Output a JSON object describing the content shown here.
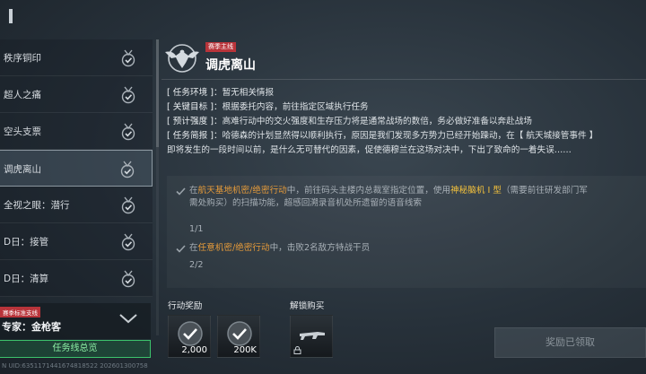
{
  "quest_list": [
    {
      "label": "秩序铜印",
      "status_icon": "check-medal-icon",
      "selected": false
    },
    {
      "label": "超人之痛",
      "status_icon": "check-medal-icon",
      "selected": false
    },
    {
      "label": "空头支票",
      "status_icon": "check-medal-icon",
      "selected": false
    },
    {
      "label": "调虎离山",
      "status_icon": "check-medal-icon",
      "selected": true
    },
    {
      "label": "全视之眼：潜行",
      "status_icon": "check-medal-icon",
      "selected": false
    },
    {
      "label": "D日：接管",
      "status_icon": "check-medal-icon",
      "selected": false
    },
    {
      "label": "D日：清算",
      "status_icon": "check-medal-icon",
      "selected": false
    }
  ],
  "expert": {
    "tag": "赛季标准支线",
    "name": "专家：金枪客",
    "overview_label": "任务线总览"
  },
  "detail": {
    "season_tag": "赛季主线",
    "title": "调虎离山",
    "env_label": "[ 任务环境 ]：",
    "env_value": "暂无相关情报",
    "goal_label": "[ 关键目标 ]：",
    "goal_value": "根据委托内容，前往指定区域执行任务",
    "intensity_label": "[ 预计强度 ]：",
    "intensity_value": "高难行动中的交火强度和生存压力将是通常战场的数倍，务必做好准备以奔赴战场",
    "brief_label": "[ 任务简报 ]：",
    "brief_line1": "哈德森的计划显然得以顺利执行，原因是我们发现多方势力已经开始躁动，在【 航天城接管事件 】",
    "brief_line2": "即将发生的一段时间以前，是什么无可替代的因素，促使德穆兰在这场对决中，下出了致命的一着失误……"
  },
  "objectives": [
    {
      "pre": "在",
      "loc": "航天基地机密/绝密行动",
      "mid": "中，前往码头主楼内总裁室指定位置，使用",
      "item": "神秘脑机 I 型",
      "post": "（需要前往研发部门军",
      "line2": "需处购买）的扫描功能，超感回溯录音机处所遗留的语音线索",
      "progress": "1/1"
    },
    {
      "pre": "在",
      "loc": "任意机密/绝密行动",
      "mid": "中，击败2名敌方特战干员",
      "progress": "2/2"
    }
  ],
  "rewards": {
    "label": "行动奖励",
    "items": [
      {
        "amount": "2,000",
        "icon": "coin-check-icon"
      },
      {
        "amount": "200K",
        "icon": "coin-check-icon"
      }
    ]
  },
  "unlock": {
    "label": "解锁购买",
    "icon": "rifle-icon"
  },
  "claim_label": "奖励已领取",
  "footer_uid": "N UID:6351171441674818522 2026013007​58",
  "colors": {
    "accent_green": "#3cc36c",
    "tag_red": "#b8343a",
    "location_orange": "#e49a3a",
    "item_yellow": "#f2c03c"
  }
}
